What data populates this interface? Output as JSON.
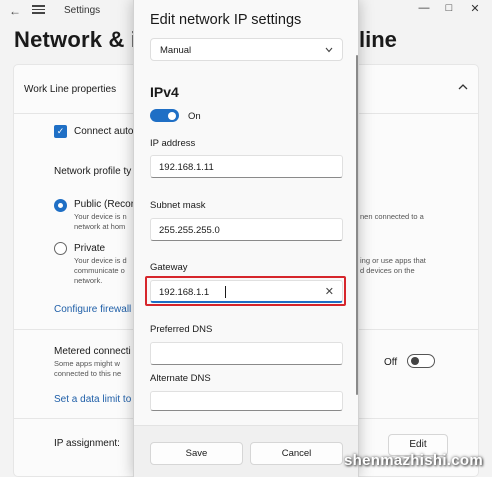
{
  "window": {
    "app_title": "Settings",
    "page_heading_left": "Network & in",
    "page_heading_right": "line"
  },
  "background": {
    "card_title": "Work Line properties",
    "connect_auto": "Connect auto",
    "network_profile_type": "Network profile ty",
    "public_label": "Public (Recor",
    "public_desc_1": "Your device is n",
    "public_desc_2": "network at hom",
    "public_desc_right": "nen connected to a",
    "private_label": "Private",
    "private_desc_1": "Your device is d",
    "private_desc_2": "communicate o",
    "private_desc_3": "network.",
    "private_desc_right_1": "ing or use apps that",
    "private_desc_right_2": "d devices on the",
    "configure_firewall": "Configure firewall",
    "metered_label": "Metered connecti",
    "metered_desc_1": "Some apps might w",
    "metered_desc_2": "connected to this ne",
    "metered_state": "Off",
    "data_limit_link": "Set a data limit to",
    "ip_assignment": "IP assignment:",
    "edit_button": "Edit"
  },
  "dialog": {
    "title": "Edit network IP settings",
    "mode_selected": "Manual",
    "section": "IPv4",
    "ipv4_toggle_state": "On",
    "fields": {
      "ip_address": {
        "label": "IP address",
        "value": "192.168.1.11"
      },
      "subnet_mask": {
        "label": "Subnet mask",
        "value": "255.255.255.0"
      },
      "gateway": {
        "label": "Gateway",
        "value": "192.168.1.1"
      },
      "preferred_dns": {
        "label": "Preferred DNS",
        "value": ""
      },
      "alternate_dns": {
        "label": "Alternate DNS",
        "value": ""
      }
    },
    "save_button": "Save",
    "cancel_button": "Cancel"
  },
  "watermark": "shenmazhishi.com",
  "colors": {
    "accent": "#1f6fc5",
    "highlight_box": "#d6262c",
    "link": "#1f5fa8"
  },
  "icons": {
    "back": "arrow-left-icon",
    "menu": "hamburger-menu-icon",
    "collapse": "chevron-up-icon",
    "dropdown": "chevron-down-icon",
    "clear": "close-icon"
  }
}
